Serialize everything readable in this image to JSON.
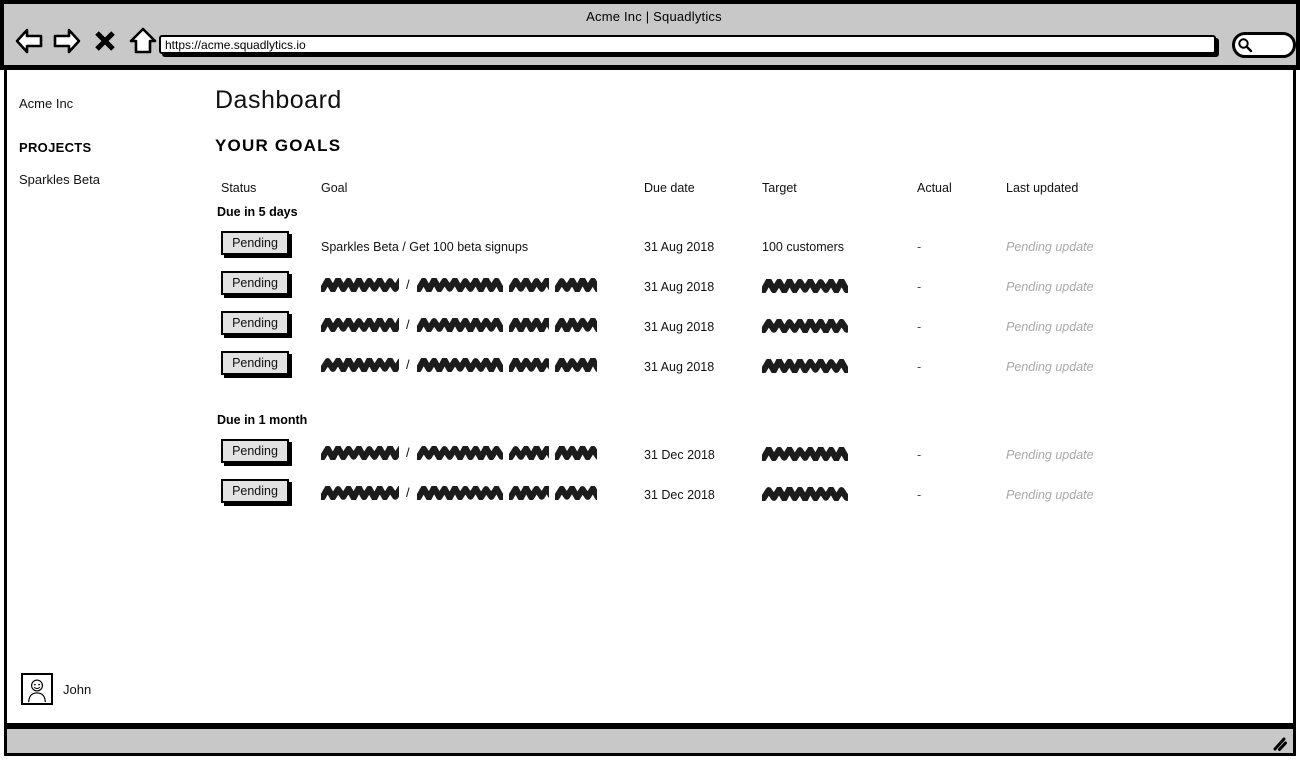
{
  "window": {
    "title": "Acme Inc | Squadlytics",
    "url": "https://acme.squadlytics.io",
    "nav": {
      "back_icon": "back-arrow-icon",
      "forward_icon": "forward-arrow-icon",
      "stop_icon": "close-x-icon",
      "home_icon": "home-icon",
      "search_icon": "search-icon",
      "resize_icon": "resize-grip-icon"
    }
  },
  "sidebar": {
    "org": "Acme Inc",
    "section_label": "PROJECTS",
    "projects": [
      "Sparkles Beta"
    ],
    "user": {
      "name": "John",
      "avatar_icon": "user-avatar-icon"
    }
  },
  "main": {
    "page_title": "Dashboard",
    "section_title": "YOUR GOALS",
    "columns": [
      "Status",
      "Goal",
      "Due date",
      "Target",
      "Actual",
      "Last updated"
    ],
    "groups": [
      {
        "label": "Due in 5 days",
        "rows": [
          {
            "status": "Pending",
            "goal": "Sparkles Beta / Get 100 beta signups",
            "goal_redacted": false,
            "due_date": "31 Aug 2018",
            "target": "100 customers",
            "target_redacted": false,
            "actual": "-",
            "last_updated": "Pending update"
          },
          {
            "status": "Pending",
            "goal": "",
            "goal_redacted": true,
            "due_date": "31 Aug 2018",
            "target": "",
            "target_redacted": true,
            "actual": "-",
            "last_updated": "Pending update"
          },
          {
            "status": "Pending",
            "goal": "",
            "goal_redacted": true,
            "due_date": "31 Aug 2018",
            "target": "",
            "target_redacted": true,
            "actual": "-",
            "last_updated": "Pending update"
          },
          {
            "status": "Pending",
            "goal": "",
            "goal_redacted": true,
            "due_date": "31 Aug 2018",
            "target": "",
            "target_redacted": true,
            "actual": "-",
            "last_updated": "Pending update"
          }
        ]
      },
      {
        "label": "Due in 1 month",
        "rows": [
          {
            "status": "Pending",
            "goal": "",
            "goal_redacted": true,
            "due_date": "31 Dec 2018",
            "target": "",
            "target_redacted": true,
            "actual": "-",
            "last_updated": "Pending update"
          },
          {
            "status": "Pending",
            "goal": "",
            "goal_redacted": true,
            "due_date": "31 Dec 2018",
            "target": "",
            "target_redacted": true,
            "actual": "-",
            "last_updated": "Pending update"
          }
        ]
      }
    ]
  },
  "colors": {
    "chrome": "#c8c8c8",
    "ink": "#000000",
    "button_fill": "#e2e2e2",
    "muted": "#a9a9a9"
  }
}
